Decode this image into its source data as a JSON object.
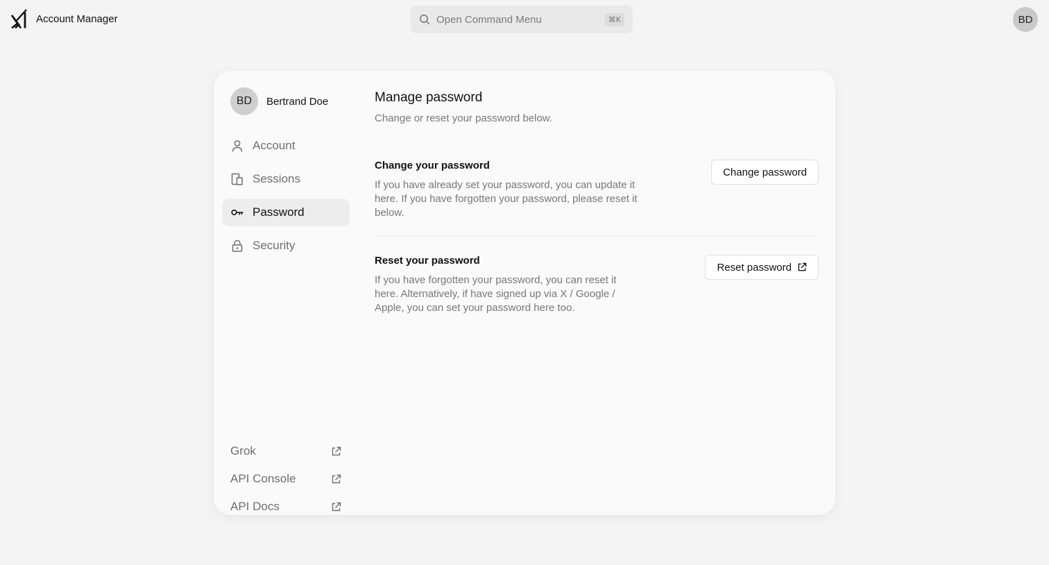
{
  "app": {
    "title": "Account Manager",
    "logo_icon": "xai-logo-icon"
  },
  "command": {
    "placeholder": "Open Command Menu",
    "shortcut": "⌘K",
    "icon": "search-icon"
  },
  "user": {
    "initials": "BD",
    "name": "Bertrand Doe"
  },
  "nav": {
    "items": [
      {
        "label": "Account",
        "icon": "user-icon",
        "active": false
      },
      {
        "label": "Sessions",
        "icon": "devices-icon",
        "active": false
      },
      {
        "label": "Password",
        "icon": "key-icon",
        "active": true
      },
      {
        "label": "Security",
        "icon": "lock-icon",
        "active": false
      }
    ]
  },
  "external_links": [
    {
      "label": "Grok",
      "icon": "external-link-icon"
    },
    {
      "label": "API Console",
      "icon": "external-link-icon"
    },
    {
      "label": "API Docs",
      "icon": "external-link-icon"
    }
  ],
  "main": {
    "title": "Manage password",
    "subtitle": "Change or reset your password below.",
    "change": {
      "title": "Change your password",
      "description": "If you have already set your password, you can update it here. If you have forgotten your password, please reset it below.",
      "button": "Change password"
    },
    "reset": {
      "title": "Reset your password",
      "description": "If you have forgotten your password, you can reset it here. Alternatively, if have signed up via X / Google / Apple, you can set your password here too.",
      "button": "Reset password",
      "button_icon": "external-link-icon"
    }
  },
  "colors": {
    "background": "#f4f4f4",
    "card": "#fafafa",
    "active_nav": "#ededed",
    "muted_text": "#777777"
  }
}
